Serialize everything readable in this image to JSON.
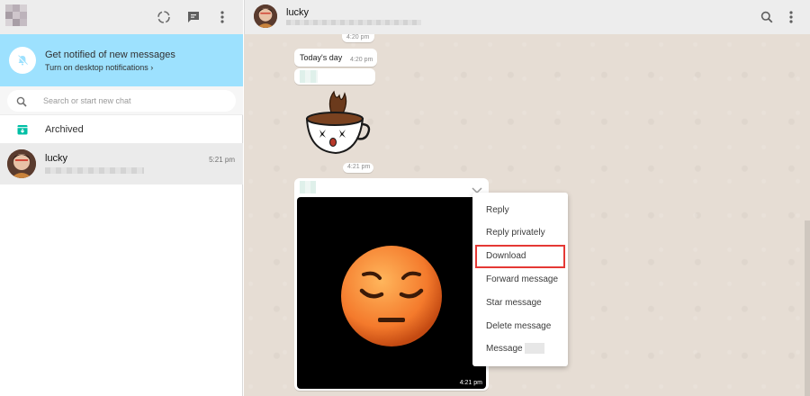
{
  "sidebar": {
    "notification": {
      "title": "Get notified of new messages",
      "subtitle": "Turn on desktop notifications ›"
    },
    "search": {
      "placeholder": "Search or start new chat"
    },
    "archived_label": "Archived",
    "chats": [
      {
        "name": "lucky",
        "time": "5:21 pm"
      }
    ]
  },
  "conversation": {
    "contact_name": "lucky",
    "messages": [
      {
        "type": "time_only",
        "time": "4:20 pm"
      },
      {
        "type": "text",
        "text": "Today's day",
        "time": "4:20 pm"
      },
      {
        "type": "sticker",
        "time": "4:21 pm"
      },
      {
        "type": "image",
        "time": "4:21 pm"
      }
    ]
  },
  "context_menu": {
    "items": [
      {
        "label": "Reply"
      },
      {
        "label": "Reply privately"
      },
      {
        "label": "Download",
        "highlighted": true
      },
      {
        "label": "Forward message"
      },
      {
        "label": "Star message"
      },
      {
        "label": "Delete message"
      },
      {
        "label": "Message"
      }
    ]
  },
  "colors": {
    "notification_bg": "#9de1fe",
    "header_bg": "#ededed",
    "chat_bg": "#e6ddd4",
    "highlight_border": "#e53935",
    "archived_icon": "#00bfa5"
  },
  "icons": {
    "left_header": [
      "status-icon",
      "new-chat-icon",
      "menu-dots-icon"
    ],
    "right_header": [
      "search-icon",
      "menu-dots-icon"
    ]
  }
}
